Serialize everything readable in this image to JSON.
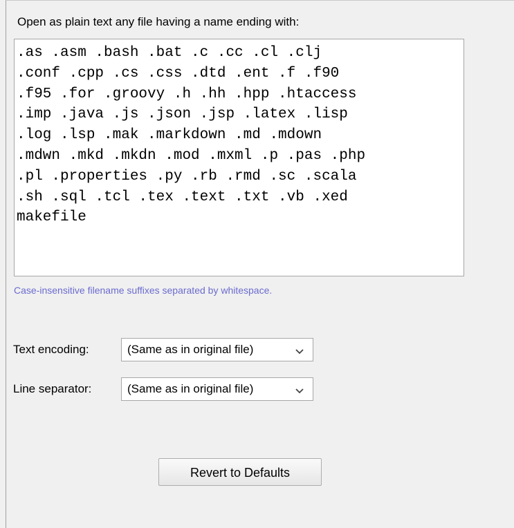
{
  "suffixes": {
    "label": "Open as plain text any file having a name ending with:",
    "value": ".as .asm .bash .bat .c .cc .cl .clj\n.conf .cpp .cs .css .dtd .ent .f .f90\n.f95 .for .groovy .h .hh .hpp .htaccess\n.imp .java .js .json .jsp .latex .lisp\n.log .lsp .mak .markdown .md .mdown\n.mdwn .mkd .mkdn .mod .mxml .p .pas .php\n.pl .properties .py .rb .rmd .sc .scala\n.sh .sql .tcl .tex .text .txt .vb .xed\nmakefile",
    "hint": "Case-insensitive filename suffixes separated by whitespace."
  },
  "text_encoding": {
    "label": "Text encoding:",
    "value": "(Same as in original file)",
    "icon": "chevron-down-icon"
  },
  "line_separator": {
    "label": "Line separator:",
    "value": "(Same as in original file)",
    "icon": "chevron-down-icon"
  },
  "revert_button": {
    "label": "Revert to Defaults"
  }
}
